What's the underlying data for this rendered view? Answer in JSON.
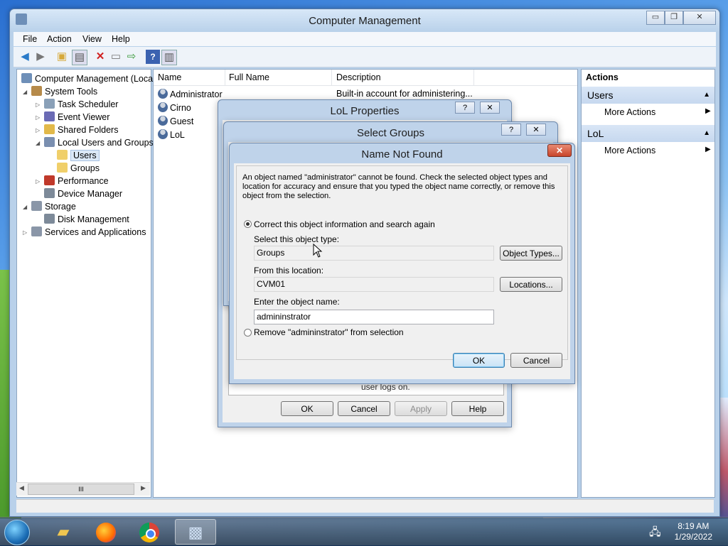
{
  "window": {
    "title": "Computer Management",
    "controls": {
      "minimize": "▭",
      "restore": "❐",
      "close": "✕"
    }
  },
  "menu": [
    "File",
    "Action",
    "View",
    "Help"
  ],
  "toolbar": {
    "icons": [
      "back-arrow-icon",
      "forward-arrow-icon",
      "folder-up-icon",
      "show-hide-tree-icon",
      "delete-icon",
      "properties-icon",
      "export-icon",
      "help-icon",
      "show-hide-action-pane-icon"
    ]
  },
  "tree": [
    {
      "label": "Computer Management (Local",
      "level": 0,
      "arrow": "",
      "icon": "computer-management-icon",
      "color": "#6e8fb8"
    },
    {
      "label": "System Tools",
      "level": 1,
      "arrow": "◢",
      "icon": "system-tools-icon",
      "color": "#b68a4a"
    },
    {
      "label": "Task Scheduler",
      "level": 2,
      "arrow": "▷",
      "icon": "task-scheduler-icon",
      "color": "#8aa0b8"
    },
    {
      "label": "Event Viewer",
      "level": 2,
      "arrow": "▷",
      "icon": "event-viewer-icon",
      "color": "#6b6bb5"
    },
    {
      "label": "Shared Folders",
      "level": 2,
      "arrow": "▷",
      "icon": "shared-folders-icon",
      "color": "#e2b94a"
    },
    {
      "label": "Local Users and Groups",
      "level": 2,
      "arrow": "◢",
      "icon": "local-users-groups-icon",
      "color": "#7a8fb0"
    },
    {
      "label": "Users",
      "level": 3,
      "arrow": "",
      "icon": "folder-icon",
      "color": "#f0cf6a",
      "selected": true
    },
    {
      "label": "Groups",
      "level": 3,
      "arrow": "",
      "icon": "folder-icon",
      "color": "#f0cf6a"
    },
    {
      "label": "Performance",
      "level": 2,
      "arrow": "▷",
      "icon": "performance-icon",
      "color": "#c0392b"
    },
    {
      "label": "Device Manager",
      "level": 2,
      "arrow": "",
      "icon": "device-manager-icon",
      "color": "#7d8a99"
    },
    {
      "label": "Storage",
      "level": 1,
      "arrow": "◢",
      "icon": "storage-icon",
      "color": "#8a96a8"
    },
    {
      "label": "Disk Management",
      "level": 2,
      "arrow": "",
      "icon": "disk-management-icon",
      "color": "#7d8a99"
    },
    {
      "label": "Services and Applications",
      "level": 1,
      "arrow": "▷",
      "icon": "services-applications-icon",
      "color": "#8a96a8"
    }
  ],
  "tree_scroll_label": "III",
  "list": {
    "columns": [
      "Name",
      "Full Name",
      "Description"
    ],
    "rows": [
      {
        "name": "Administrator",
        "full_name": "",
        "description": "Built-in account for administering..."
      },
      {
        "name": "Cirno",
        "full_name": "",
        "description": ""
      },
      {
        "name": "Guest",
        "full_name": "",
        "description": ""
      },
      {
        "name": "LoL",
        "full_name": "",
        "description": ""
      }
    ]
  },
  "actions": {
    "header": "Actions",
    "sections": [
      {
        "title": "Users",
        "item": "More Actions"
      },
      {
        "title": "LoL",
        "item": "More Actions"
      }
    ]
  },
  "lol_properties": {
    "title": "LoL Properties",
    "help": "?",
    "close": "✕",
    "partial_text": "user logs on.",
    "buttons": {
      "ok": "OK",
      "cancel": "Cancel",
      "apply": "Apply",
      "help": "Help"
    }
  },
  "select_groups": {
    "title": "Select Groups",
    "help": "?",
    "close": "✕"
  },
  "name_not_found": {
    "title": "Name Not Found",
    "close": "✕",
    "message": "An object named \"administrator\" cannot be found. Check the selected object types and location for accuracy and ensure that you typed the object name correctly, or remove this object from the selection.",
    "option_correct": "Correct this object information and search again",
    "object_type_label": "Select this object type:",
    "object_type_value": "Groups",
    "object_types_button": "Object Types...",
    "location_label": "From this location:",
    "location_value": "CVM01",
    "locations_button": "Locations...",
    "object_name_label": "Enter the object name:",
    "object_name_value": "admininstrator",
    "option_remove": "Remove \"admininstrator\" from selection",
    "ok": "OK",
    "cancel": "Cancel"
  },
  "taskbar": {
    "apps": [
      "file-explorer-icon",
      "firefox-icon",
      "chrome-icon",
      "computer-management-app-icon"
    ],
    "time": "8:19 AM",
    "date": "1/29/2022"
  }
}
